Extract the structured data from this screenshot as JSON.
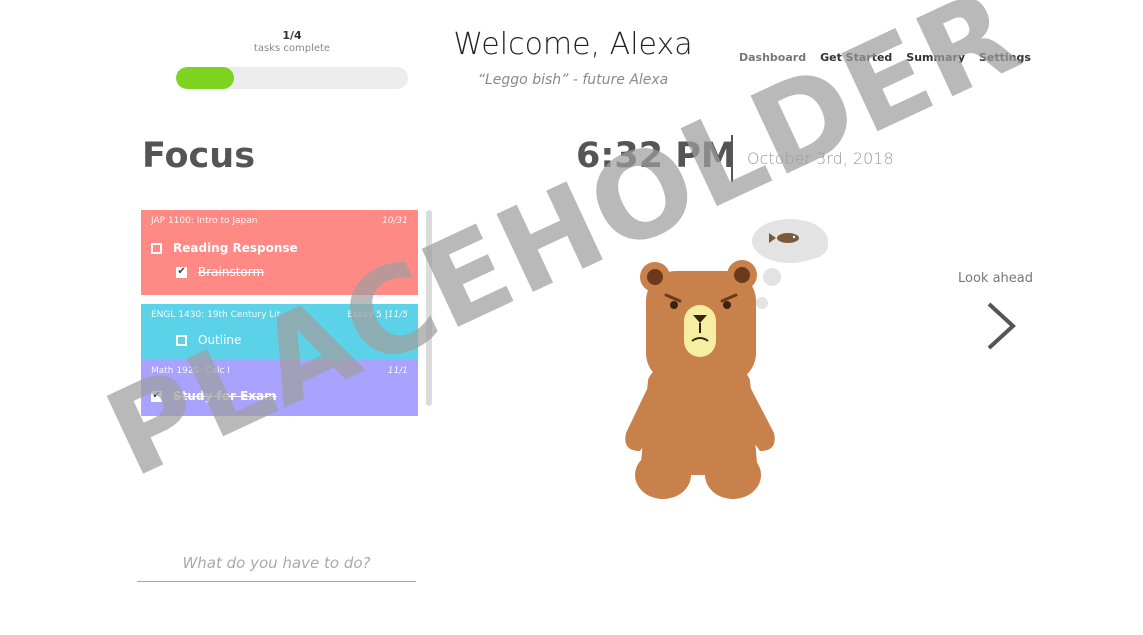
{
  "progress": {
    "count": "1/4",
    "label": "tasks complete",
    "fraction": 0.25,
    "color": "#7ed321"
  },
  "header": {
    "title": "Welcome, Alexa",
    "quote": "“Leggo bish” - future Alexa"
  },
  "nav": [
    {
      "label": "Dashboard",
      "active": false
    },
    {
      "label": "Get Started",
      "active": true
    },
    {
      "label": "Summary",
      "active": true
    },
    {
      "label": "Settings",
      "active": true
    }
  ],
  "focus": {
    "title": "Focus"
  },
  "clock": {
    "time": "6:32 PM",
    "date": "October 3rd, 2018"
  },
  "courses": [
    {
      "color": "#ff8a85",
      "name": "JAP 1100: Intro to Japan",
      "tag": "",
      "due": "10/31",
      "tasks": [
        {
          "label": "Reading Response",
          "checked": false,
          "bold": true,
          "indent": false
        },
        {
          "label": "Brainstorm",
          "checked": true,
          "bold": false,
          "indent": true
        }
      ]
    },
    {
      "color": "#5bd2e8",
      "name": "ENGL 1430: 19th Century Lit",
      "tag": "Essay 5 |",
      "due": "11/5",
      "tasks": [
        {
          "label": "Outline",
          "checked": false,
          "bold": false,
          "indent": true
        }
      ]
    },
    {
      "color": "#aaa2ff",
      "name": "Math 1920: Calc I",
      "tag": "",
      "due": "11/1",
      "tasks": [
        {
          "label": "Study for Exam",
          "checked": true,
          "bold": true,
          "indent": false
        }
      ]
    }
  ],
  "new_task": {
    "placeholder": "What do you have to do?"
  },
  "look_ahead": {
    "label": "Look ahead",
    "icon": "chevron-right-icon"
  },
  "watermark": {
    "text": "PLACEHOLDER"
  },
  "colors": {
    "bear": "#c8814a",
    "bear_dark": "#6b3a1a",
    "muzzle": "#f6eea0",
    "text_dark": "#555555"
  }
}
